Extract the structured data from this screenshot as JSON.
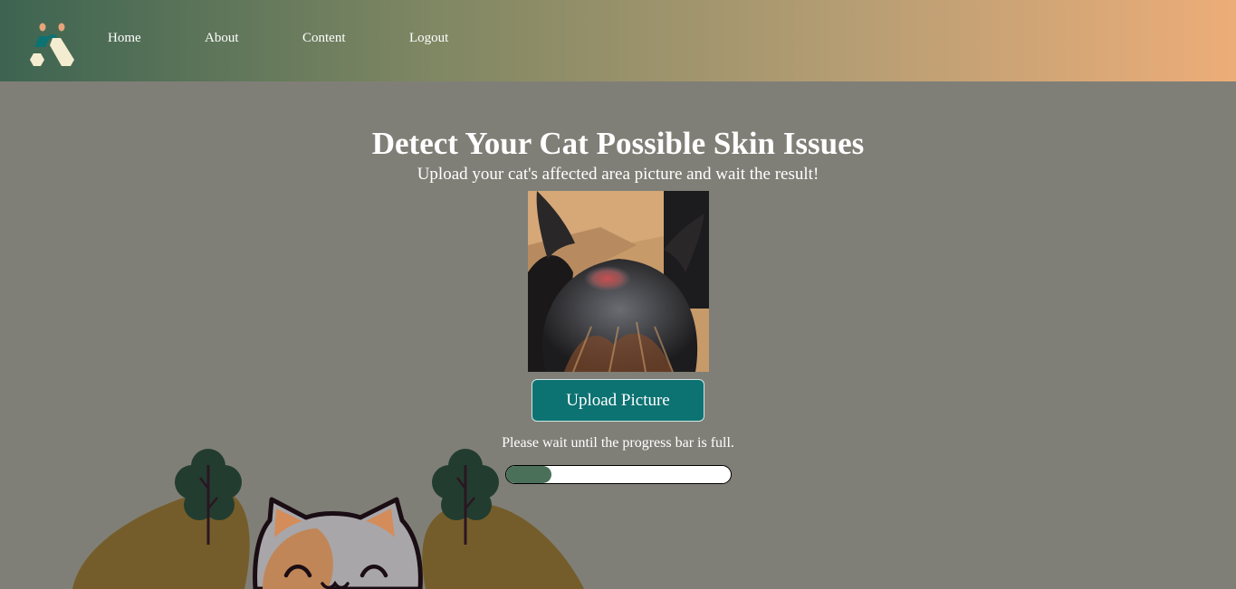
{
  "header": {
    "nav": [
      {
        "label": "Home"
      },
      {
        "label": "About"
      },
      {
        "label": "Content"
      },
      {
        "label": "Logout"
      }
    ]
  },
  "main": {
    "title": "Detect Your Cat Possible Skin Issues",
    "subtitle": "Upload your cat's affected area picture and wait the result!",
    "upload_button": "Upload Picture",
    "wait_message": "Please wait until the progress bar is full.",
    "progress_fraction": 0.2
  },
  "colors": {
    "header_gradient": [
      "#3d6451",
      "#7f8763",
      "#b89e74",
      "#edad78"
    ],
    "background": "#807f77",
    "upload_button": "#0d7272",
    "progress_fill": "#4a7059"
  },
  "icons": {
    "logo": "cat-logo-icon"
  }
}
